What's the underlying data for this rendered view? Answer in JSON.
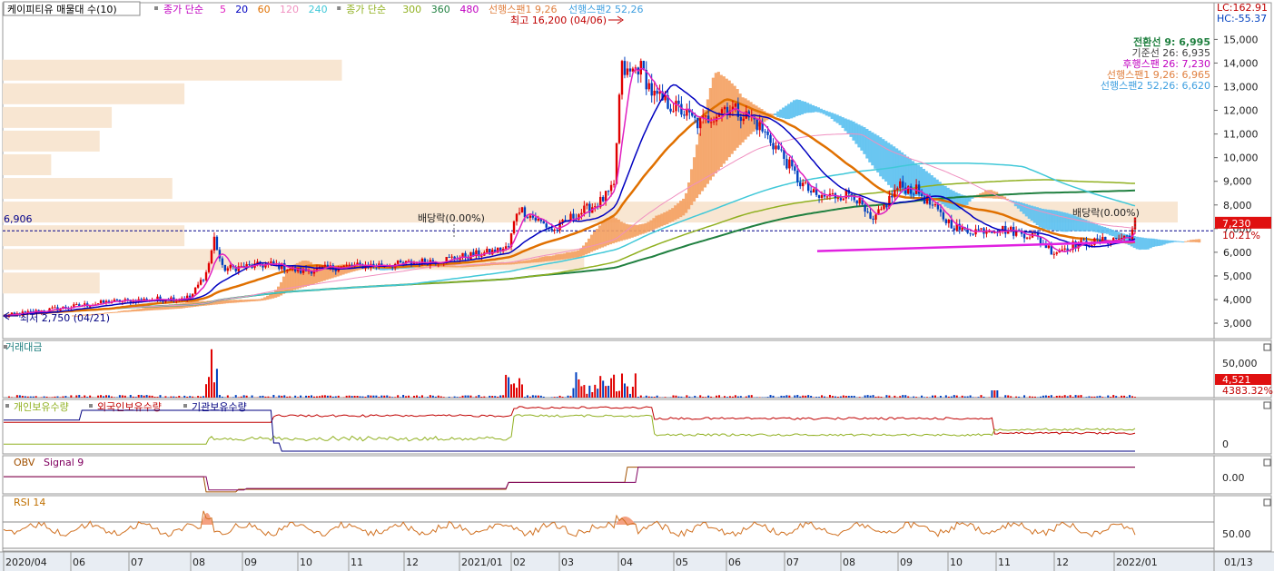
{
  "header": {
    "title": "케이피티유 매물대 수(10)",
    "ma_label": "종가 단순",
    "ma_periods": [
      {
        "p": "5",
        "color": "#e020c0"
      },
      {
        "p": "20",
        "color": "#0000c0"
      },
      {
        "p": "60",
        "color": "#e07000"
      },
      {
        "p": "120",
        "color": "#f090c0"
      },
      {
        "p": "240",
        "color": "#40c8d8"
      }
    ],
    "ma_label2": "종가 단순",
    "ma_periods2": [
      {
        "p": "300",
        "color": "#90b020"
      },
      {
        "p": "360",
        "color": "#208040"
      },
      {
        "p": "480",
        "color": "#c000c0"
      }
    ],
    "span1_label": "선행스팬1 9,26",
    "span2_label": "선행스팬2 52,26",
    "lc_label": "LC:162.91",
    "hc_label": "HC:-55.37"
  },
  "ichimoku_legend": [
    {
      "text": "전환선 9: 6,995",
      "color": "#208040"
    },
    {
      "text": "기준선 26: 6,935",
      "color": "#404040"
    },
    {
      "text": "후행스팬 26: 7,230",
      "color": "#c000c0"
    },
    {
      "text": "선행스팬1 9,26: 6,965",
      "color": "#e08040"
    },
    {
      "text": "선행스팬2 52,26: 6,620",
      "color": "#40a0e0"
    }
  ],
  "annotations": {
    "high": "최고 16,200 (04/06)",
    "low": "최저 2,750 (04/21)",
    "dividend1": "배당락(0.00%)",
    "dividend2": "배당락(0.00%)",
    "ref_price": "6,906",
    "current_price": "7,230",
    "current_pct": "10.21%"
  },
  "panels": {
    "volume_title": "거래대금",
    "volume_tick": "50,000",
    "volume_current": "4,521",
    "volume_pct": "4383.32%",
    "holdings_title": [
      "개인보유수량",
      "외국인보유수량",
      "기관보유수량"
    ],
    "holdings_colors": [
      "#90b020",
      "#c00000",
      "#000080"
    ],
    "holdings_tick": "0",
    "obv_title": "OBV",
    "obv_signal": "Signal 9",
    "obv_tick": "0.00",
    "rsi_title": "RSI 14",
    "rsi_tick": "50.00"
  },
  "xaxis": {
    "labels": [
      "2020/04",
      "06",
      "07",
      "08",
      "09",
      "10",
      "11",
      "12",
      "2021/01",
      "02",
      "03",
      "04",
      "05",
      "06",
      "07",
      "08",
      "09",
      "10",
      "11",
      "12",
      "2022/01"
    ],
    "right_label": "01/13"
  },
  "chart_data": {
    "type": "candlestick",
    "yticks": [
      3000,
      4000,
      5000,
      6000,
      7000,
      8000,
      9000,
      10000,
      11000,
      12000,
      13000,
      14000,
      15000
    ],
    "ylim": [
      2350,
      16550
    ],
    "x_range": [
      "2020/04",
      "2022/01"
    ],
    "price_series": {
      "dates": [
        "2020/04",
        "2020/05",
        "2020/06",
        "2020/07",
        "2020/08",
        "2020/09",
        "2020/10",
        "2020/11",
        "2020/12",
        "2021/01",
        "2021/02",
        "2021/03",
        "2021/04",
        "2021/05",
        "2021/06",
        "2021/07",
        "2021/08",
        "2021/09",
        "2021/10",
        "2021/11",
        "2021/12",
        "2022/01"
      ],
      "close": [
        3200,
        3600,
        3900,
        4000,
        5600,
        5300,
        5400,
        5500,
        5800,
        6100,
        7100,
        8000,
        13500,
        11000,
        11500,
        9500,
        8200,
        8300,
        6800,
        6600,
        6200,
        7230
      ]
    },
    "high": {
      "value": 16200,
      "date": "04/06"
    },
    "low": {
      "value": 2750,
      "date": "04/21"
    },
    "reference_price": 6906,
    "current_price": 7230,
    "volume_profile": [
      {
        "price": 13700,
        "len": 0.28
      },
      {
        "price": 12700,
        "len": 0.15
      },
      {
        "price": 11700,
        "len": 0.09
      },
      {
        "price": 10700,
        "len": 0.08
      },
      {
        "price": 9700,
        "len": 0.04
      },
      {
        "price": 8700,
        "len": 0.14
      },
      {
        "price": 7700,
        "len": 0.97
      },
      {
        "price": 6700,
        "len": 0.15
      },
      {
        "price": 5700,
        "len": 0.48
      },
      {
        "price": 4700,
        "len": 0.08
      }
    ]
  }
}
